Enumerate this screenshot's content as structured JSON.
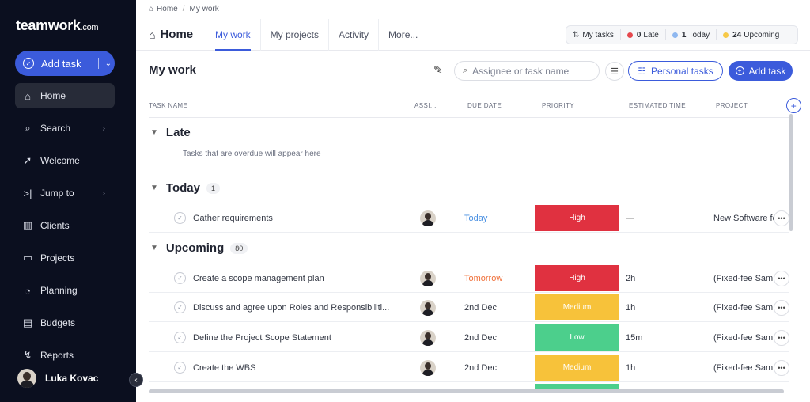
{
  "sidebar": {
    "logo": "teamwork",
    "logo_suffix": ".com",
    "add_task_label": "Add task",
    "items": [
      {
        "label": "Home",
        "icon": "home-icon"
      },
      {
        "label": "Search",
        "icon": "search-icon"
      },
      {
        "label": "Welcome",
        "icon": "rocket-icon"
      },
      {
        "label": "Jump to",
        "icon": "jump-icon"
      },
      {
        "label": "Clients",
        "icon": "building-icon"
      },
      {
        "label": "Projects",
        "icon": "folder-icon"
      },
      {
        "label": "Planning",
        "icon": "planning-icon"
      },
      {
        "label": "Budgets",
        "icon": "budget-icon"
      },
      {
        "label": "Reports",
        "icon": "reports-icon"
      }
    ],
    "user_name": "Luka Kovac"
  },
  "breadcrumb": {
    "home": "Home",
    "current": "My work"
  },
  "header": {
    "title": "Home",
    "tabs": [
      "My work",
      "My projects",
      "Activity",
      "More..."
    ],
    "stats": {
      "my_tasks": "My tasks",
      "late_count": "0",
      "late_label": "Late",
      "today_count": "1",
      "today_label": "Today",
      "upcoming_count": "24",
      "upcoming_label": "Upcoming"
    },
    "colors": {
      "late": "#e5484d",
      "today": "#8fb8f0",
      "upcoming": "#f7c948"
    }
  },
  "page": {
    "title": "My work",
    "search_placeholder": "Assignee or task name",
    "personal_tasks_label": "Personal tasks",
    "add_task_label": "Add task"
  },
  "table": {
    "columns": [
      "TASK NAME",
      "ASSI...",
      "DUE DATE",
      "PRIORITY",
      "ESTIMATED TIME",
      "PROJECT"
    ]
  },
  "sections": {
    "late": {
      "title": "Late",
      "empty_text": "Tasks that are overdue will appear here"
    },
    "today": {
      "title": "Today",
      "count": "1",
      "rows": [
        {
          "name": "Gather requirements",
          "due": "Today",
          "due_color": "#4a90e2",
          "priority": "High",
          "priority_color": "#e03140",
          "estimate": "—",
          "project": "New Software fo"
        }
      ]
    },
    "upcoming": {
      "title": "Upcoming",
      "count": "80",
      "rows": [
        {
          "name": "Create a scope management plan",
          "due": "Tomorrow",
          "due_color": "#f0703a",
          "priority": "High",
          "priority_color": "#e03140",
          "estimate": "2h",
          "project": "(Fixed-fee Samp"
        },
        {
          "name": "Discuss and agree upon Roles and Responsibiliti...",
          "due": "2nd Dec",
          "due_color": "#333844",
          "priority": "Medium",
          "priority_color": "#f7c23a",
          "estimate": "1h",
          "project": "(Fixed-fee Samp"
        },
        {
          "name": "Define the Project Scope Statement",
          "due": "2nd Dec",
          "due_color": "#333844",
          "priority": "Low",
          "priority_color": "#4ccf8c",
          "estimate": "15m",
          "project": "(Fixed-fee Samp"
        },
        {
          "name": "Create the WBS",
          "due": "2nd Dec",
          "due_color": "#333844",
          "priority": "Medium",
          "priority_color": "#f7c23a",
          "estimate": "1h",
          "project": "(Fixed-fee Samp"
        }
      ]
    }
  }
}
